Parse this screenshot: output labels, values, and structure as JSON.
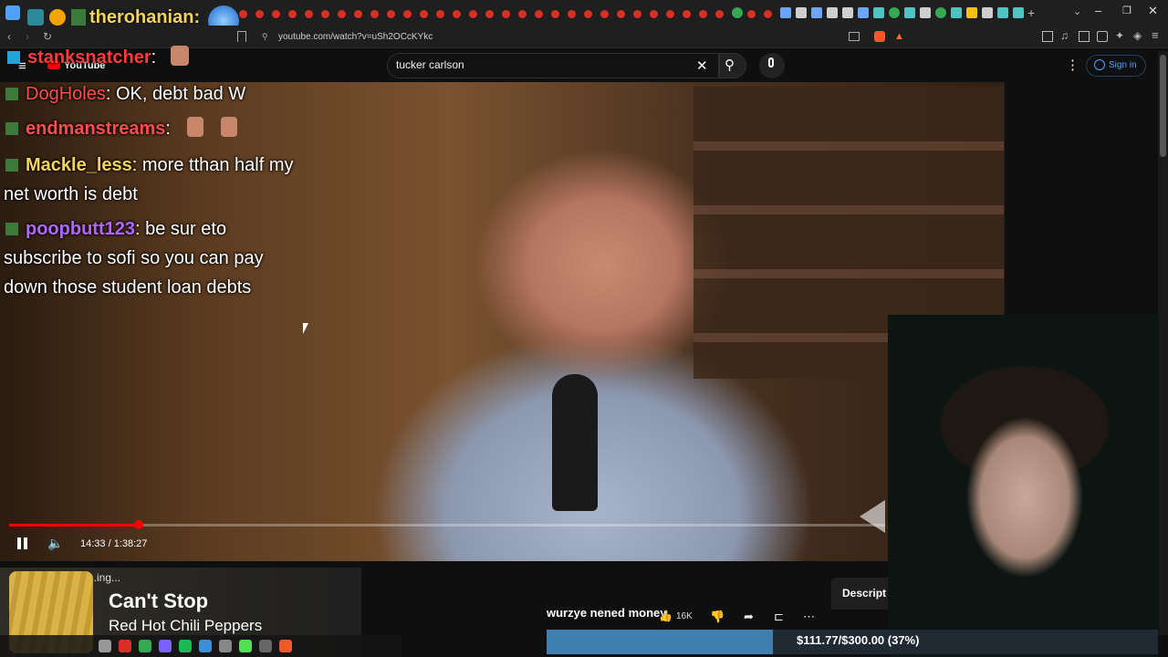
{
  "browser": {
    "streamer_overlay_name": "therohanian:",
    "url": "youtube.com/watch?v=uSh2OCcKYkc"
  },
  "youtube": {
    "logo_text": "YouTube",
    "search_query": "tucker carlson",
    "sign_in_label": "Sign in"
  },
  "chat": [
    {
      "user": "stanksnatcher",
      "sep": ":",
      "message": "",
      "color": "#ff3b3b"
    },
    {
      "user": "DogHoles",
      "sep": ":",
      "message": " OK, debt bad W",
      "color": "#ff4d4d"
    },
    {
      "user": "endmanstreams",
      "sep": ":",
      "message": "",
      "color": "#ff4d4d"
    },
    {
      "user": "Mackle_less",
      "sep": ":",
      "message": " more tthan half my",
      "message2": "net worth is debt",
      "color": "#f2d35b"
    },
    {
      "user": "poopbutt123",
      "sep": ":",
      "message": " be sur eto",
      "message2": "subscribe to sofi so you can pay",
      "message3": "down those student loan debts",
      "color": "#b266ff"
    }
  ],
  "player": {
    "time": "14:33 / 1:38:27",
    "progress_fraction": 0.148
  },
  "music": {
    "status": "...ing...",
    "song": "Can't Stop",
    "artist": "Red Hot Chili Peppers"
  },
  "video_row": {
    "title_overlay": "wurzye nened money",
    "likes": "16K",
    "description_tab": "Descript"
  },
  "donation": {
    "text": "$111.77/$300.00 (37%)",
    "fraction": 0.37
  }
}
